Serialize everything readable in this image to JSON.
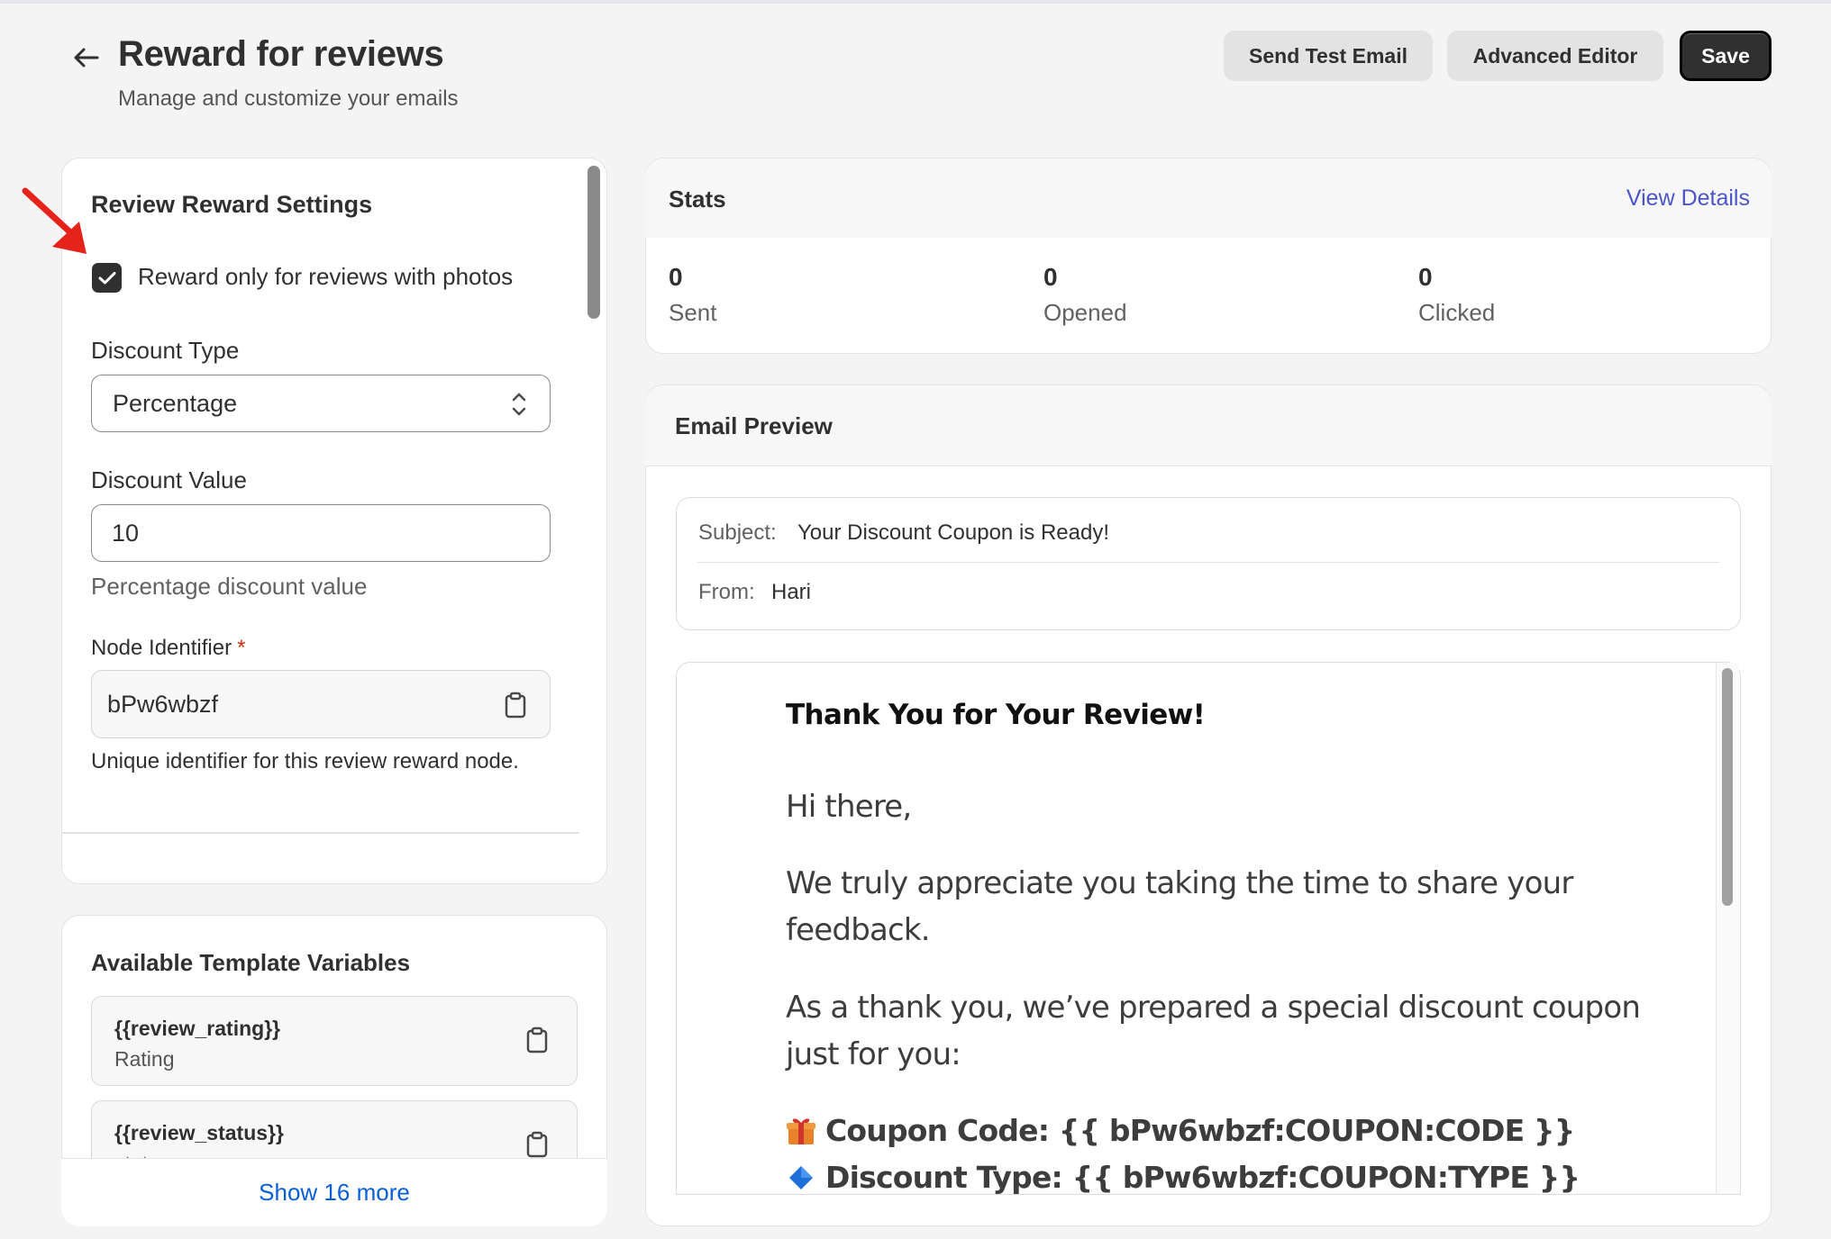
{
  "header": {
    "title": "Reward for reviews",
    "subtitle": "Manage and customize your emails",
    "buttons": {
      "send_test": "Send Test Email",
      "advanced_editor": "Advanced Editor",
      "save": "Save"
    }
  },
  "settings": {
    "title": "Review Reward Settings",
    "photos_only": {
      "label": "Reward only for reviews with photos",
      "checked": true
    },
    "discount_type": {
      "label": "Discount Type",
      "value": "Percentage"
    },
    "discount_value": {
      "label": "Discount Value",
      "value": "10",
      "help": "Percentage discount value"
    },
    "node_identifier": {
      "label": "Node Identifier",
      "required_mark": "*",
      "value": "bPw6wbzf",
      "help": "Unique identifier for this review reward node."
    }
  },
  "variables": {
    "title": "Available Template Variables",
    "items": [
      {
        "name": "{{review_rating}}",
        "desc": "Rating"
      },
      {
        "name": "{{review_status}}",
        "desc": "status"
      }
    ],
    "show_more": "Show 16 more"
  },
  "stats": {
    "title": "Stats",
    "view_details": "View Details",
    "items": [
      {
        "value": "0",
        "label": "Sent"
      },
      {
        "value": "0",
        "label": "Opened"
      },
      {
        "value": "0",
        "label": "Clicked"
      }
    ]
  },
  "preview": {
    "title": "Email Preview",
    "subject_label": "Subject:",
    "subject": "Your Discount Coupon is Ready!",
    "from_label": "From:",
    "from": "Hari",
    "body": {
      "heading": "Thank You for Your Review!",
      "greeting": "Hi there,",
      "p1_line1": "We truly appreciate you taking the time to share your",
      "p1_line2": "feedback.",
      "p2_line1": "As a thank you, we’ve prepared a special discount coupon",
      "p2_line2": "just for you:",
      "coupon_code": "Coupon Code: {{ bPw6wbzf:COUPON:CODE }}",
      "discount_type": "Discount Type: {{ bPw6wbzf:COUPON:TYPE }}"
    }
  },
  "colors": {
    "accent_link": "#4b55c8",
    "show_more_link": "#0a5ed7",
    "primary_button": "#303030",
    "annotation_arrow": "#e5231b"
  }
}
